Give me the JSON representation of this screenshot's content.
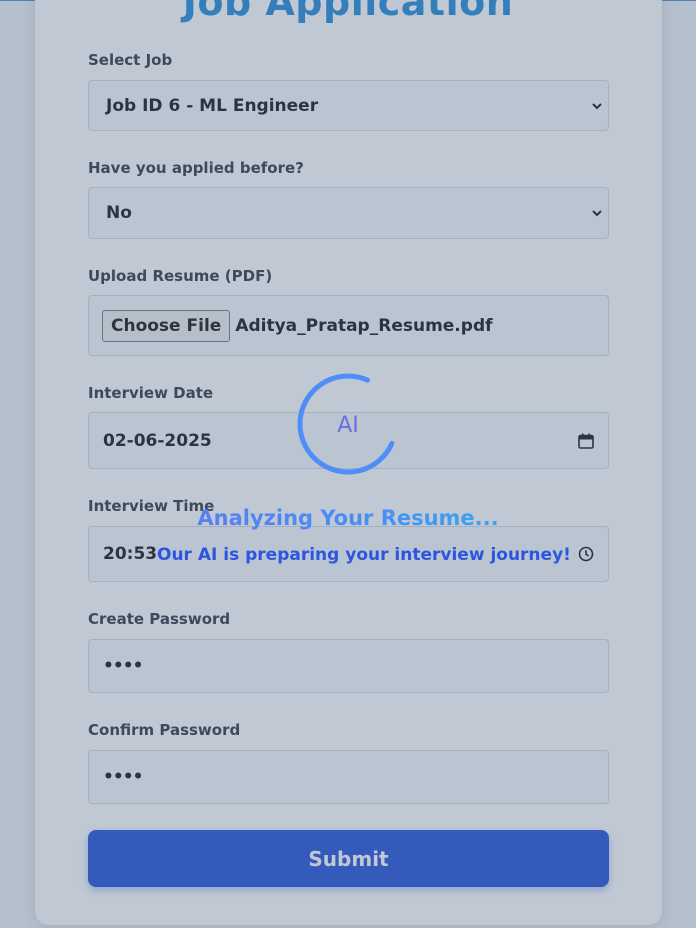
{
  "form": {
    "title": "Job Application",
    "select_job": {
      "label": "Select Job",
      "value": "Job ID 6 - ML Engineer"
    },
    "applied_before": {
      "label": "Have you applied before?",
      "value": "No"
    },
    "resume": {
      "label": "Upload Resume (PDF)",
      "button": "Choose File",
      "file_name": "Aditya_Pratap_Resume.pdf"
    },
    "interview_date": {
      "label": "Interview Date",
      "value": "02-06-2025"
    },
    "interview_time": {
      "label": "Interview Time",
      "value": "20:53"
    },
    "password": {
      "label": "Create Password",
      "value": "••••"
    },
    "confirm_password": {
      "label": "Confirm Password",
      "value": "••••"
    },
    "submit_label": "Submit"
  },
  "loading": {
    "spinner_text": "AI",
    "title": "Analyzing Your Resume...",
    "message": "Our AI is preparing your interview journey!"
  },
  "colors": {
    "accent": "#1d4ed8",
    "title": "#1e88d8",
    "spinner": "#4f8ef7"
  },
  "icons": {
    "select_job": "chevron-down-icon",
    "applied_before": "chevron-down-icon",
    "interview_date": "calendar-icon",
    "interview_time": "clock-icon"
  }
}
